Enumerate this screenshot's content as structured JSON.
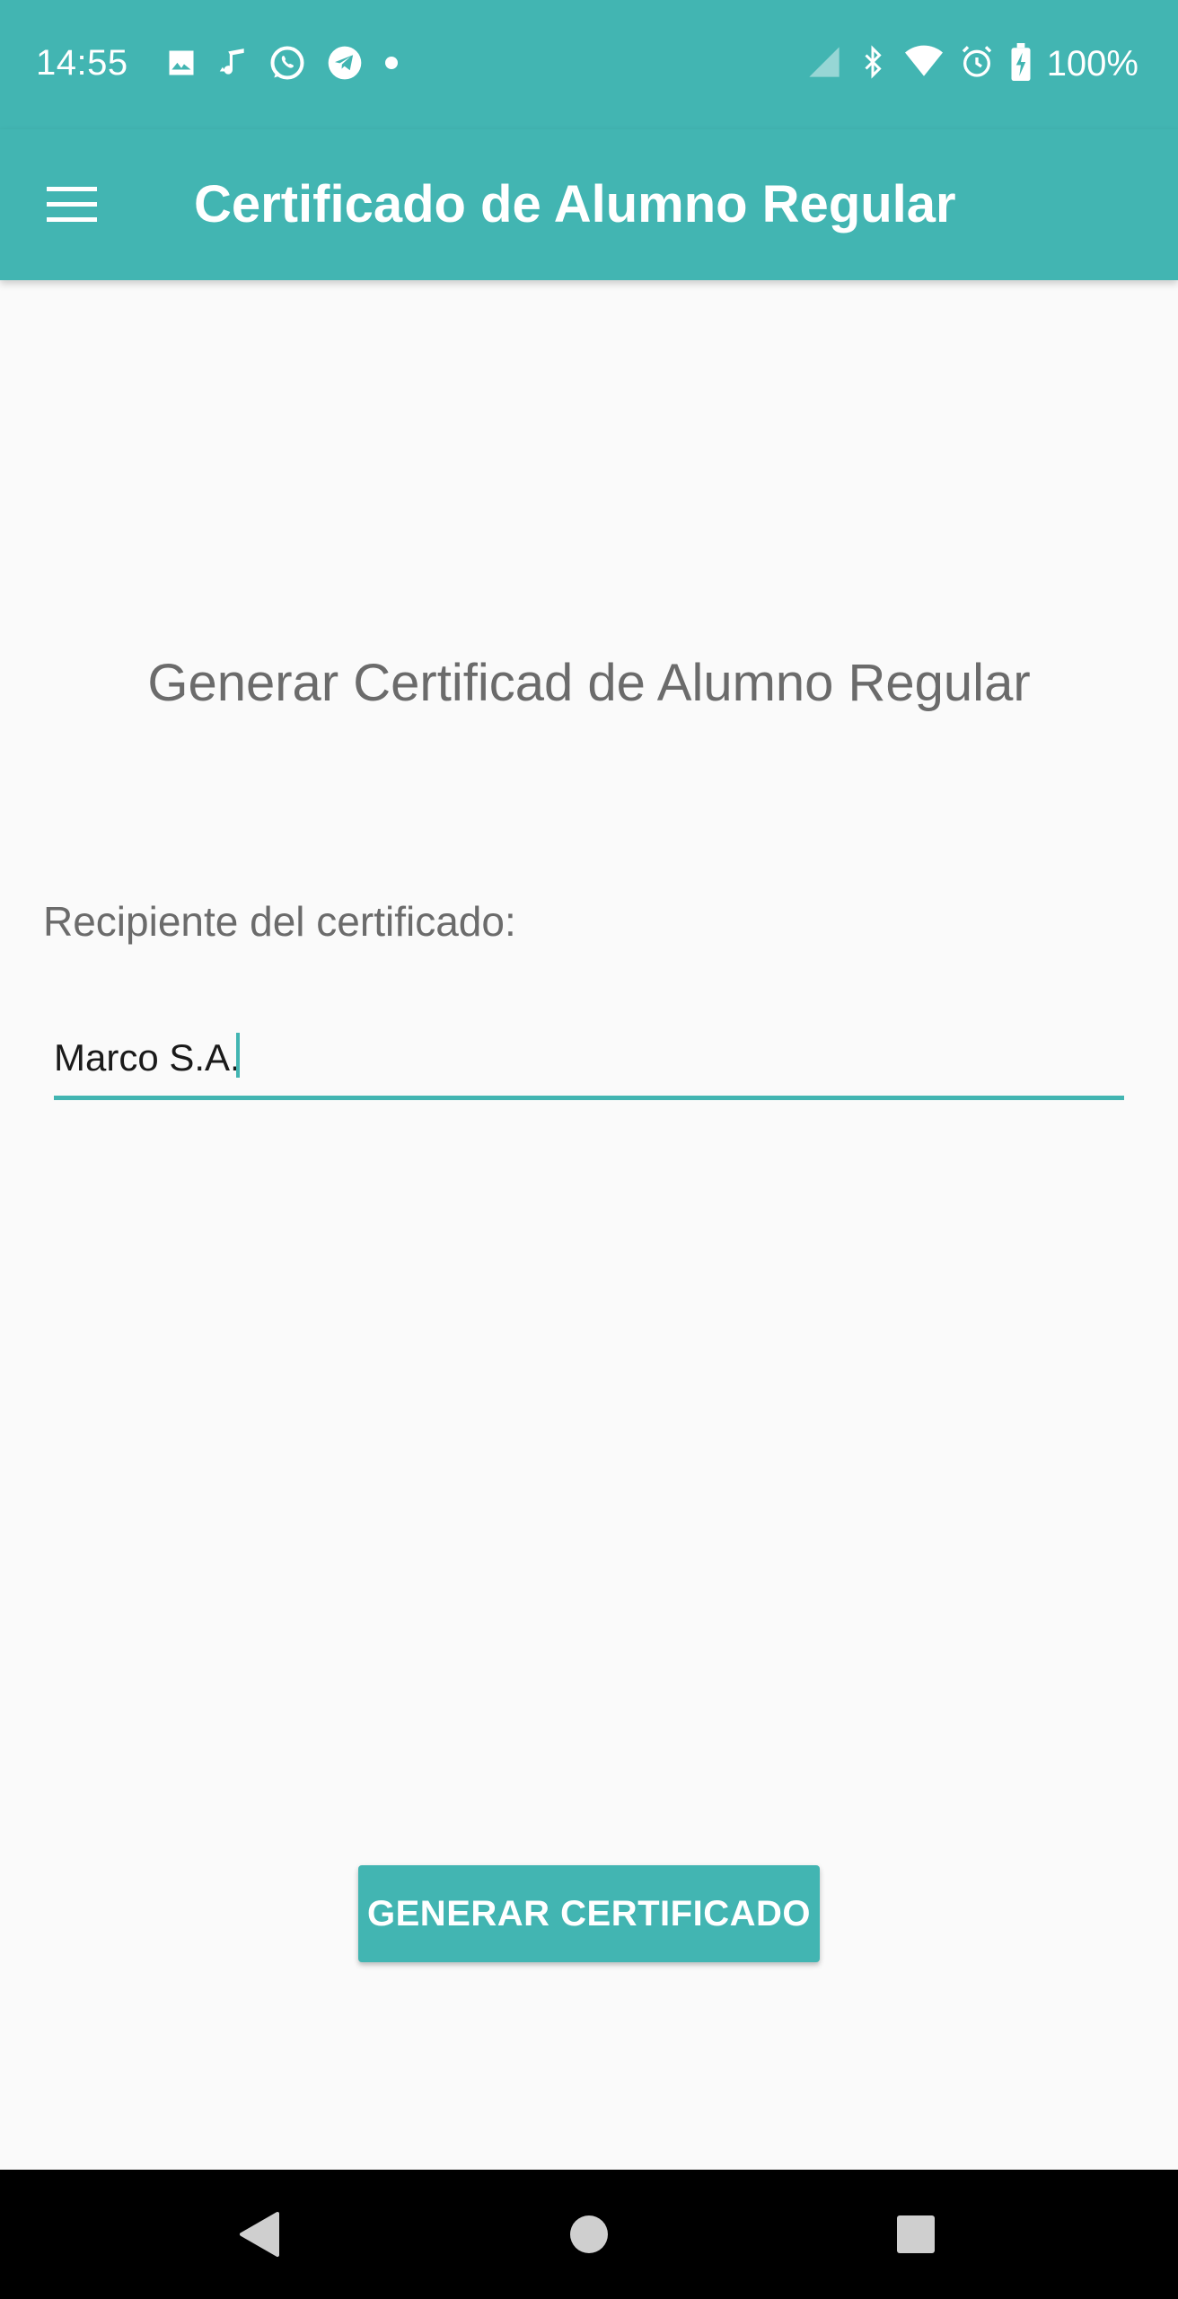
{
  "status_bar": {
    "time": "14:55",
    "battery_percent": "100%",
    "left_icons": [
      "image-icon",
      "music-icon",
      "whatsapp-icon",
      "telegram-icon",
      "more-dot-icon"
    ],
    "right_icons": [
      "signal-icon",
      "bluetooth-icon",
      "wifi-icon",
      "alarm-icon",
      "battery-charging-icon"
    ]
  },
  "app_bar": {
    "menu_icon": "hamburger-menu-icon",
    "title": "Certificado de Alumno Regular"
  },
  "main": {
    "heading": "Generar Certificad de Alumno Regular",
    "recipient_label": "Recipiente del certificado:",
    "recipient_value": "Marco S.A.",
    "generate_button_label": "GENERAR CERTIFICADO"
  },
  "nav_bar": {
    "buttons": [
      "back-icon",
      "home-icon",
      "recents-icon"
    ]
  },
  "colors": {
    "primary": "#42b5b2",
    "background": "#fafafa",
    "text_secondary": "#6b6b6b",
    "nav_bar": "#000000"
  }
}
